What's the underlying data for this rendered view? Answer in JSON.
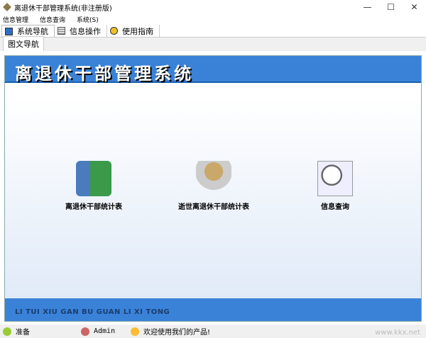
{
  "window": {
    "title": "离退休干部管理系统(非注册版)",
    "minimize": "—",
    "maximize": "☐",
    "close": "✕"
  },
  "menu": [
    "信息管理",
    "信息查询",
    "系统(S)"
  ],
  "toolbar": [
    {
      "label": "系统导航",
      "icon": "monitor-icon"
    },
    {
      "label": "信息操作",
      "icon": "grid-icon"
    },
    {
      "label": "使用指南",
      "icon": "help-icon"
    }
  ],
  "subtab": "图文导航",
  "banner": {
    "title": "离退休干部管理系统",
    "subtitle": "LI TUI XIU GAN BU GUAN LI XI TONG"
  },
  "nav": [
    {
      "label": "离退休干部统计表",
      "icon": "person-book-icon"
    },
    {
      "label": "逝世离退休干部统计表",
      "icon": "memorial-icon"
    },
    {
      "label": "信息查询",
      "icon": "magnifier-icon"
    }
  ],
  "status": {
    "state": "准备",
    "user": "Admin",
    "message": "欢迎使用我们的产品!"
  },
  "watermark": "www.kkx.net",
  "colors": {
    "banner": "#3a82d8"
  }
}
